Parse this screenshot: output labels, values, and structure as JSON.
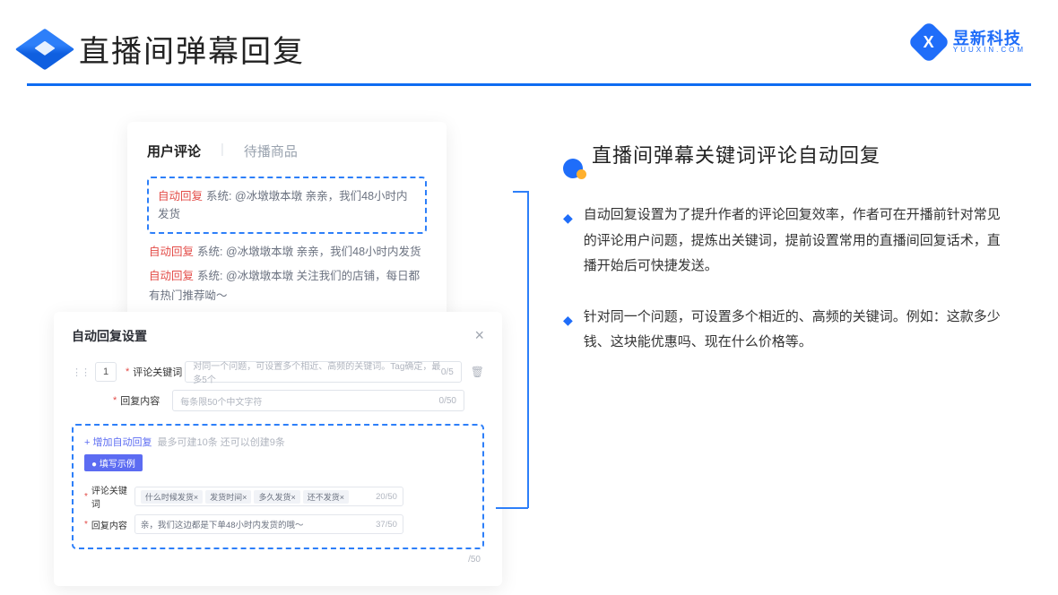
{
  "header": {
    "title": "直播间弹幕回复"
  },
  "brand": {
    "cn": "昱新科技",
    "en": "YUUXIN.COM",
    "mark": "X"
  },
  "card1": {
    "tab_active": "用户评论",
    "tab_inactive": "待播商品",
    "highlighted": {
      "badge": "自动回复",
      "text": "系统: @冰墩墩本墩 亲亲，我们48小时内发货"
    },
    "lines": [
      {
        "badge": "自动回复",
        "text": "系统: @冰墩墩本墩 亲亲，我们48小时内发货"
      },
      {
        "badge": "自动回复",
        "text": "系统: @冰墩墩本墩 关注我们的店铺，每日都有热门推荐呦～"
      }
    ]
  },
  "modal": {
    "title": "自动回复设置",
    "num": "1",
    "row1": {
      "label": "评论关键词",
      "ph": "对同一个问题，可设置多个相近、高频的关键词。Tag确定，最多5个",
      "count": "0/5"
    },
    "row2": {
      "label": "回复内容",
      "ph": "每条限50个中文字符",
      "count": "0/50"
    },
    "add_link": "+ 增加自动回复",
    "add_hint": "最多可建10条 还可以创建9条",
    "ex_badge": "● 填写示例",
    "ex1": {
      "label": "评论关键词",
      "t1": "什么时候发货×",
      "t2": "发货时间×",
      "t3": "多久发货×",
      "t4": "还不发货×",
      "count": "20/50"
    },
    "ex2": {
      "label": "回复内容",
      "text": "亲，我们这边都是下单48小时内发货的哦～",
      "count": "37/50"
    },
    "faded": "/50"
  },
  "right": {
    "heading": "直播间弹幕关键词评论自动回复",
    "bul1": "自动回复设置为了提升作者的评论回复效率，作者可在开播前针对常见的评论用户问题，提炼出关键词，提前设置常用的直播间回复话术，直播开始后可快捷发送。",
    "bul2": "针对同一个问题，可设置多个相近的、高频的关键词。例如：这款多少钱、这块能优惠吗、现在什么价格等。"
  }
}
